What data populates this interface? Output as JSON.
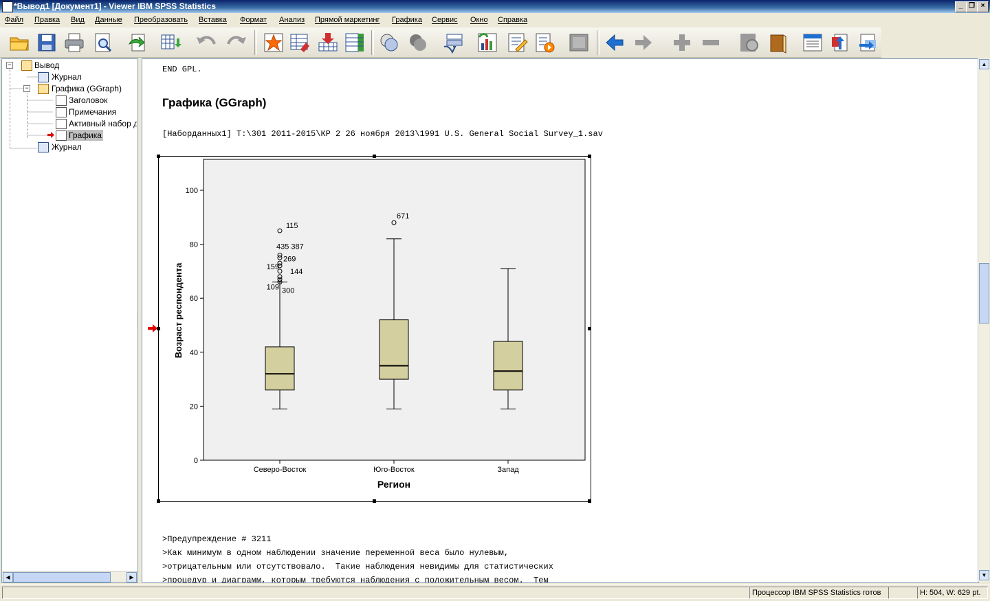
{
  "window": {
    "title": "*Вывод1 [Документ1] - Viewer IBM SPSS Statistics"
  },
  "menu": [
    "Файл",
    "Правка",
    "Вид",
    "Данные",
    "Преобразовать",
    "Вставка",
    "Формат",
    "Анализ",
    "Прямой маркетинг",
    "Графика",
    "Сервис",
    "Окно",
    "Справка"
  ],
  "tree": {
    "root": "Вывод",
    "items": [
      "Журнал",
      "Графика (GGraph)",
      "Заголовок",
      "Примечания",
      "Активный набор д",
      "Графика",
      "Журнал"
    ]
  },
  "content": {
    "syntax_end": "END GPL.",
    "section_title": "Графика (GGraph)",
    "dataset_line": "[Наборданных1] T:\\301 2011-2015\\КР 2 26 ноября 2013\\1991 U.S. General Social Survey_1.sav",
    "warning_lines": [
      ">Предупреждение # 3211",
      ">Как минимум в одном наблюдении значение переменной веса было нулевым,",
      ">отрицательным или отсутствовало.  Такие наблюдения невидимы для статистических",
      ">процедур и диаграмм, которым требуются наблюдения с положительным весом.  Тем"
    ]
  },
  "chart_data": {
    "type": "box",
    "xlabel": "Регион",
    "ylabel": "Возраст респондента",
    "ylim": [
      0,
      100
    ],
    "yticks": [
      0,
      20,
      40,
      60,
      80,
      100
    ],
    "categories": [
      "Северо-Восток",
      "Юго-Восток",
      "Запад"
    ],
    "boxes": [
      {
        "min": 19,
        "q1": 26,
        "median": 32,
        "q3": 42,
        "max": 66
      },
      {
        "min": 19,
        "q1": 30,
        "median": 35,
        "q3": 52,
        "max": 82
      },
      {
        "min": 19,
        "q1": 26,
        "median": 33,
        "q3": 44,
        "max": 71
      }
    ],
    "outliers": [
      {
        "cat": 0,
        "y": 85,
        "label": "115"
      },
      {
        "cat": 0,
        "y": 76,
        "label": "435 387"
      },
      {
        "cat": 0,
        "y": 75,
        "label": "269"
      },
      {
        "cat": 0,
        "y": 73,
        "label": "159"
      },
      {
        "cat": 0,
        "y": 72,
        "label": "144"
      },
      {
        "cat": 0,
        "y": 70,
        "label": ""
      },
      {
        "cat": 0,
        "y": 68,
        "label": ""
      },
      {
        "cat": 0,
        "y": 67,
        "label": "109"
      },
      {
        "cat": 0,
        "y": 66,
        "label": "300"
      },
      {
        "cat": 1,
        "y": 88,
        "label": "671"
      }
    ],
    "colors": {
      "box_fill": "#d4cf9f",
      "plot_bg": "#f0f0f0"
    }
  },
  "status": {
    "processor": "Процессор IBM SPSS Statistics  готов",
    "size": "H: 504, W: 629 pt."
  }
}
